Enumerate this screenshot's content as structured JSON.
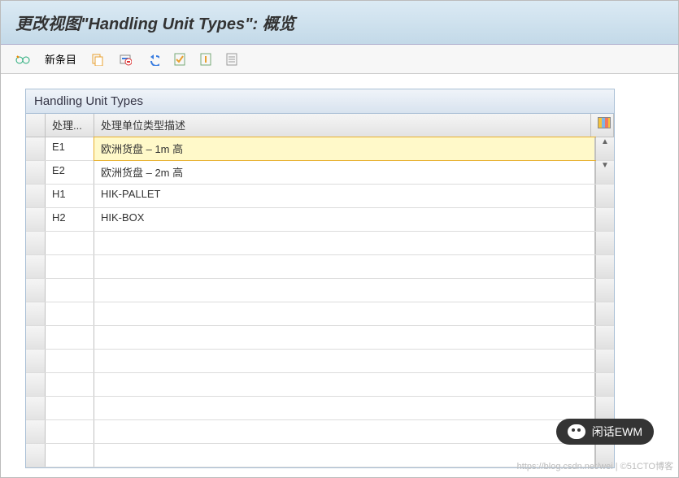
{
  "title": "更改视图\"Handling Unit Types\":  概览",
  "toolbar": {
    "new_entry_label": "新条目"
  },
  "panel": {
    "title": "Handling Unit Types",
    "columns": {
      "code": "处理...",
      "desc": "处理单位类型描述"
    },
    "rows": [
      {
        "code": "E1",
        "desc": "欧洲货盘 – 1m 高",
        "selected": true
      },
      {
        "code": "E2",
        "desc": "欧洲货盘 – 2m 高",
        "selected": false
      },
      {
        "code": "H1",
        "desc": "HIK-PALLET",
        "selected": false
      },
      {
        "code": "H2",
        "desc": "HIK-BOX",
        "selected": false
      }
    ],
    "empty_rows": 10
  },
  "footer": {
    "wechat_label": "闲话EWM",
    "watermark": "https://blog.csdn.net/wei | ©51CTO博客"
  }
}
